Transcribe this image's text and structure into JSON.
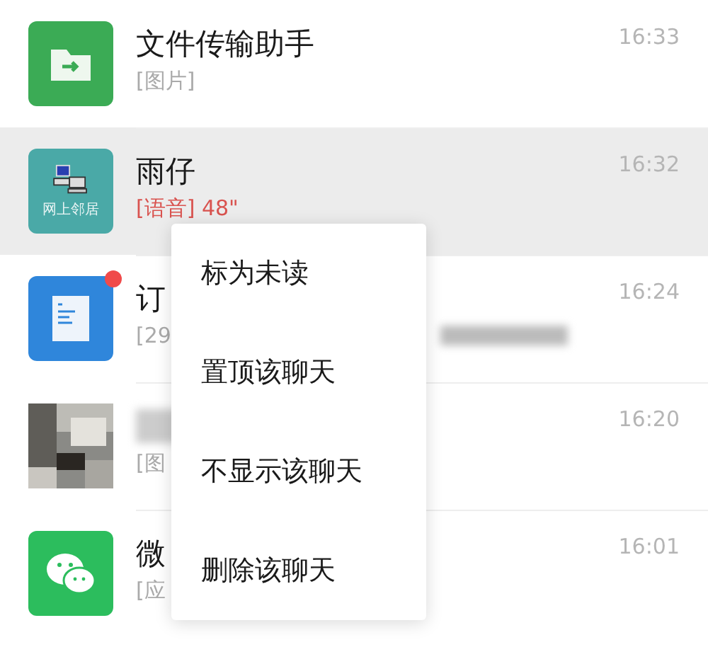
{
  "chats": [
    {
      "avatar": {
        "kind": "folder"
      },
      "name": "文件传输助手",
      "preview": "[图片]",
      "voice": false,
      "time": "16:33",
      "selected": false,
      "unread": false
    },
    {
      "avatar": {
        "kind": "computer",
        "caption": "网上邻居"
      },
      "name": "雨仔",
      "preview": "[语音] 48\"",
      "voice": true,
      "time": "16:32",
      "selected": true,
      "unread": false
    },
    {
      "avatar": {
        "kind": "document"
      },
      "name": "订",
      "preview": "[29",
      "voice": false,
      "time": "16:24",
      "selected": false,
      "unread": true,
      "blurred_preview": true
    },
    {
      "blurred_name": true,
      "preview": "[图",
      "voice": false,
      "time": "16:20",
      "selected": false,
      "unread": false
    },
    {
      "avatar": {
        "kind": "chat"
      },
      "name": "微",
      "preview": "[应",
      "voice": false,
      "time": "16:01",
      "selected": false,
      "unread": false
    }
  ],
  "context_menu": [
    "标为未读",
    "置顶该聊天",
    "不显示该聊天",
    "删除该聊天"
  ]
}
